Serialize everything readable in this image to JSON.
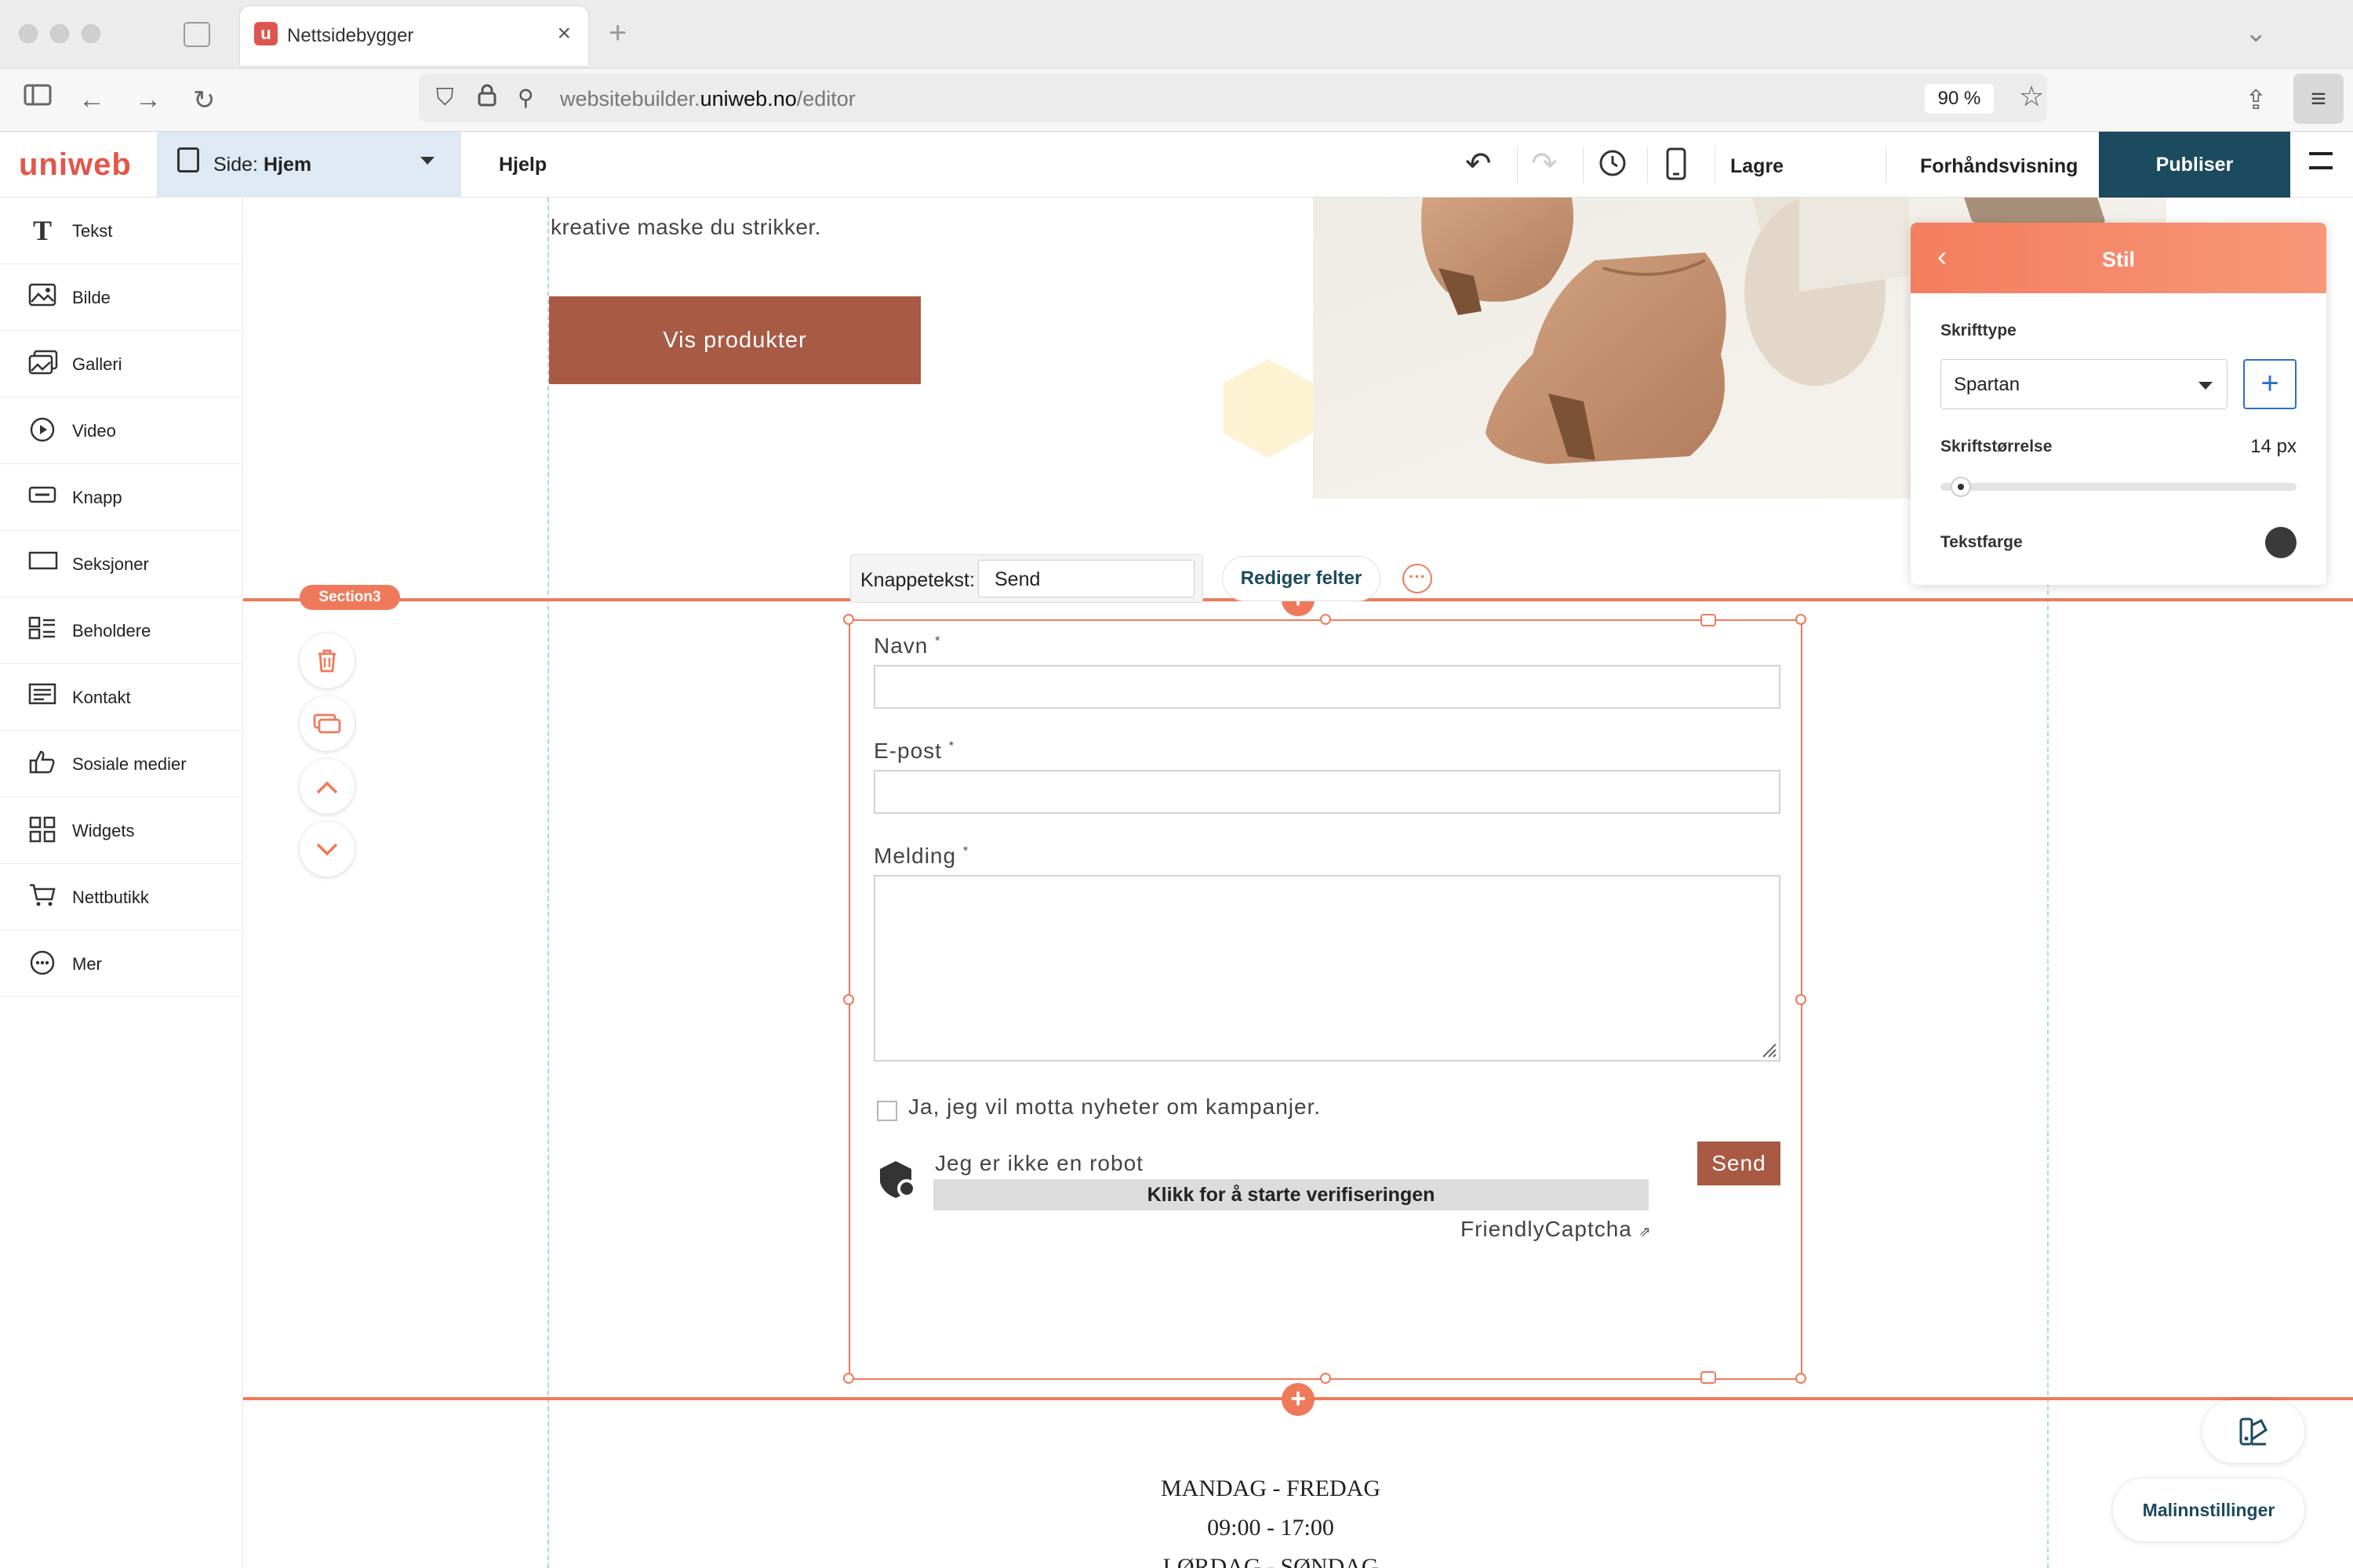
{
  "browser": {
    "tab_title": "Nettsidebygger",
    "tab_favicon": "u",
    "url_domain_prefix": "websitebuilder.",
    "url_domain_main": "uniweb.no",
    "url_path": "/editor",
    "zoom": "90 %"
  },
  "toolbar": {
    "logo": "uniweb",
    "page_label": "Side:",
    "page_value": "Hjem",
    "help": "Hjelp",
    "save": "Lagre",
    "preview": "Forhåndsvisning",
    "publish": "Publiser",
    "colors": {
      "publish_bg": "#1c4a5e",
      "accent": "#ef7a5b",
      "logo": "#e4564a"
    }
  },
  "sidebar": {
    "items": [
      {
        "label": "Tekst",
        "icon": "text-icon"
      },
      {
        "label": "Bilde",
        "icon": "image-icon"
      },
      {
        "label": "Galleri",
        "icon": "gallery-icon"
      },
      {
        "label": "Video",
        "icon": "video-icon"
      },
      {
        "label": "Knapp",
        "icon": "button-icon"
      },
      {
        "label": "Seksjoner",
        "icon": "sections-icon"
      },
      {
        "label": "Beholdere",
        "icon": "containers-icon"
      },
      {
        "label": "Kontakt",
        "icon": "contact-icon"
      },
      {
        "label": "Sosiale medier",
        "icon": "thumbs-up-icon"
      },
      {
        "label": "Widgets",
        "icon": "widgets-icon"
      },
      {
        "label": "Nettbutikk",
        "icon": "cart-icon"
      },
      {
        "label": "Mer",
        "icon": "more-icon"
      }
    ]
  },
  "hero": {
    "text_line": "kreative maske du strikker.",
    "cta": "Vis produkter"
  },
  "section": {
    "badge": "Section3"
  },
  "form_toolbar": {
    "button_text_label": "Knappetekst:",
    "button_text_value": "Send",
    "edit_fields": "Rediger felter"
  },
  "form": {
    "name_label": "Navn",
    "email_label": "E-post",
    "message_label": "Melding",
    "required_mark": "*",
    "newsletter": "Ja, jeg vil motta nyheter om kampanjer.",
    "captcha_robot": "Jeg er ikke en robot",
    "captcha_button": "Klikk for å starte verifiseringen",
    "captcha_brand": "FriendlyCaptcha",
    "submit": "Send"
  },
  "hours": {
    "weekdays": "MANDAG - FREDAG",
    "weekdays_time": "09:00 - 17:00",
    "weekend": "LØRDAG - SØNDAG"
  },
  "style_panel": {
    "title": "Stil",
    "font_label": "Skrifttype",
    "font_value": "Spartan",
    "size_label": "Skriftstørrelse",
    "size_value": "14 px",
    "size_slider_fraction": 0.03,
    "color_label": "Tekstfarge",
    "text_color": "#3a3a3a"
  },
  "template_button": "Malinnstillinger"
}
